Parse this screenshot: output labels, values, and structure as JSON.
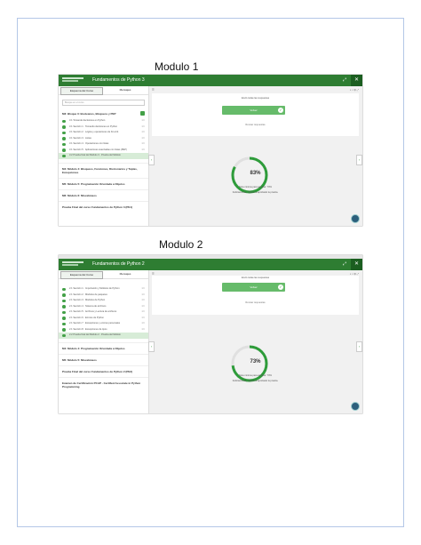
{
  "modules": [
    {
      "title": "Modulo 1",
      "course_title": "Fundamentos de Python 3",
      "tabs": [
        "Esquema del Curso",
        "Mensajes"
      ],
      "search_placeholder": "Busque en el curso",
      "section_heading": "M3: Bloque 3: Booleanos, Bloqueos y PEP",
      "lessons": [
        {
          "label": "3.1 Tomando decisiones en Python",
          "duration": "1 h"
        },
        {
          "label": "3.1 Sección 1 · Tomando decisiones en Python",
          "duration": "1 h"
        },
        {
          "label": "3.1 Sección 2 · Lógica y operaciones de bit a bit",
          "duration": "1 h"
        },
        {
          "label": "3.1 Sección 3 · Listas",
          "duration": "1 h"
        },
        {
          "label": "3.1 Sección 4 · Operaciones con listas",
          "duration": "1 h"
        },
        {
          "label": "3.1 Sección 5 · Aplicaciones avanzadas con listas (PEP)",
          "duration": "1 h"
        },
        {
          "label": "3.2 Prueba final del Módulo 3 · Prueba del Módulo",
          "duration": ""
        }
      ],
      "modules_list": [
        "M4: Módulo 4: Bloqueos, Funciones, Diccionarios y Tuplas, Excepciones",
        "M5: Módulo 5: Programación Orientada a Objetos",
        "M6: Módulo 6: Misceláneos",
        "Prueba Final del curso Fundamentos de Python 3 (PE1)"
      ],
      "question_text": "Envió todas las respuestas",
      "button_label": "Volver",
      "review_link": "Revisar respuestas",
      "percent": "83%",
      "percent_value": 83,
      "score_line": "Nota mínima para aprobar: 70%",
      "result_text": "Felicitaciones, Usted ha aprobado la prueba."
    },
    {
      "title": "Modulo 2",
      "course_title": "Fundamentos de Python 2",
      "tabs": [
        "Esquema del Curso",
        "Mensajes"
      ],
      "search_placeholder": "",
      "section_heading": "",
      "lessons": [
        {
          "label": "2.1 Sección 1 · Importación y Módulos de Python",
          "duration": "1 h"
        },
        {
          "label": "2.1 Sección 2 · Módulos de paquetes",
          "duration": "1 h"
        },
        {
          "label": "2.1 Sección 3 · Módulos de Python",
          "duration": "1 h"
        },
        {
          "label": "2.1 Sección 4 · Sistema de archivos",
          "duration": "1 h"
        },
        {
          "label": "2.1 Sección 5 · Archivos y Lectura de archivos",
          "duration": "1 h"
        },
        {
          "label": "2.1 Sección 6 · Errores de Python",
          "duration": "1 h"
        },
        {
          "label": "2.1 Sección 7 · Excepciones y errores personales",
          "duration": "1 h"
        },
        {
          "label": "2.1 Sección 8 · Excepciones de tipos",
          "duration": "1 h"
        },
        {
          "label": "2.2 Prueba final del Módulo 2 · Prueba del Módulo",
          "duration": ""
        }
      ],
      "modules_list": [
        "M4: Módulo 4: Programación Orientada a Objetos",
        "M5: Módulo 5: Misceláneos",
        "Prueba Final del curso Fundamentos de Python 2 (PE2)",
        "Examen de Certificación PCAP - Certified Associate in Python Programming"
      ],
      "question_text": "Envió todas las respuestas",
      "button_label": "Volver",
      "review_link": "Revisar respuestas",
      "percent": "73%",
      "percent_value": 73,
      "score_line": "Nota mínima para aprobar: 70%",
      "result_text": "Felicitaciones, Usted ha aprobado la prueba."
    }
  ],
  "colors": {
    "accent": "#2e7d32",
    "button": "#66bb6a",
    "border": "#b4c7e7"
  }
}
